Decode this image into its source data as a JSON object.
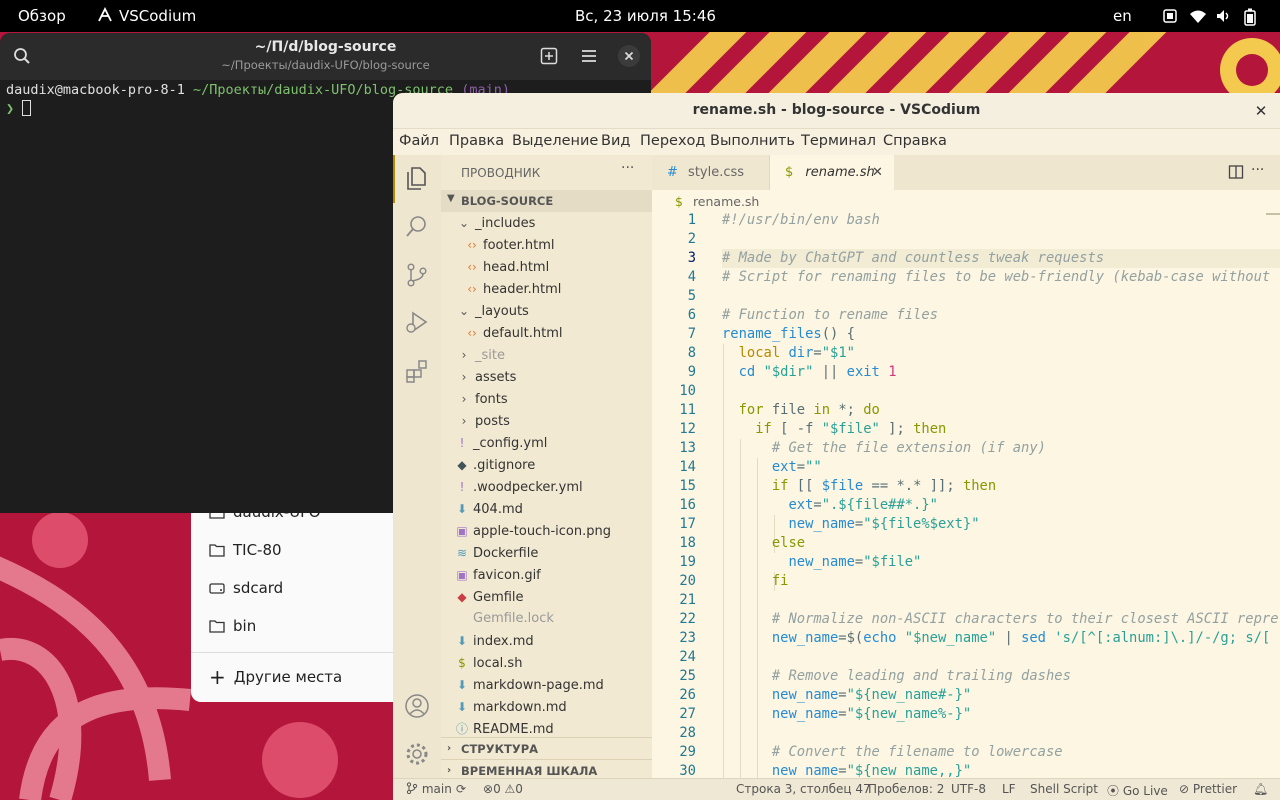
{
  "topbar": {
    "activities": "Обзор",
    "app_name": "VSCodium",
    "clock": "Вс, 23 июля  15:46",
    "lang": "en"
  },
  "nautilus": {
    "items": [
      {
        "label": "daudix-UFO",
        "icon": "folder-icon"
      },
      {
        "label": "TIC-80",
        "icon": "folder-icon"
      },
      {
        "label": "sdcard",
        "icon": "drive-icon"
      },
      {
        "label": "bin",
        "icon": "folder-icon"
      }
    ],
    "other_places": "Другие места"
  },
  "terminal": {
    "title": "~/П/d/blog-source",
    "subtitle": "~/Проекты/daudix-UFO/blog-source",
    "prompt_user": "daudix",
    "prompt_host": "@macbook-pro-8-1",
    "prompt_path": "~/Проекты/daudix-UFO/blog-source",
    "prompt_branch": "(main)",
    "prompt_symbol": "❯"
  },
  "vscode": {
    "title": "rename.sh - blog-source - VSCodium",
    "menu": [
      "Файл",
      "Правка",
      "Выделение",
      "Вид",
      "Переход",
      "Выполнить",
      "Терминал",
      "Справка"
    ],
    "explorer": {
      "header": "ПРОВОДНИК",
      "more": "···",
      "root": "BLOG-SOURCE",
      "tree": [
        {
          "label": "_includes",
          "type": "folder-open",
          "depth": 1
        },
        {
          "label": "footer.html",
          "type": "html",
          "depth": 2
        },
        {
          "label": "head.html",
          "type": "html",
          "depth": 2
        },
        {
          "label": "header.html",
          "type": "html",
          "depth": 2
        },
        {
          "label": "_layouts",
          "type": "folder-open",
          "depth": 1
        },
        {
          "label": "default.html",
          "type": "html",
          "depth": 2
        },
        {
          "label": "_site",
          "type": "folder",
          "depth": 1,
          "dim": true
        },
        {
          "label": "assets",
          "type": "folder",
          "depth": 1
        },
        {
          "label": "fonts",
          "type": "folder",
          "depth": 1
        },
        {
          "label": "posts",
          "type": "folder",
          "depth": 1
        },
        {
          "label": "_config.yml",
          "type": "yml",
          "depth": 1
        },
        {
          "label": ".gitignore",
          "type": "git",
          "depth": 1
        },
        {
          "label": ".woodpecker.yml",
          "type": "yml",
          "depth": 1
        },
        {
          "label": "404.md",
          "type": "md",
          "depth": 1
        },
        {
          "label": "apple-touch-icon.png",
          "type": "img",
          "depth": 1
        },
        {
          "label": "Dockerfile",
          "type": "docker",
          "depth": 1
        },
        {
          "label": "favicon.gif",
          "type": "img",
          "depth": 1
        },
        {
          "label": "Gemfile",
          "type": "ruby",
          "depth": 1
        },
        {
          "label": "Gemfile.lock",
          "type": "lock",
          "depth": 1,
          "dim": true
        },
        {
          "label": "index.md",
          "type": "md",
          "depth": 1
        },
        {
          "label": "local.sh",
          "type": "sh",
          "depth": 1
        },
        {
          "label": "markdown-page.md",
          "type": "md",
          "depth": 1
        },
        {
          "label": "markdown.md",
          "type": "md",
          "depth": 1
        },
        {
          "label": "README.md",
          "type": "info",
          "depth": 1
        }
      ],
      "outline": "СТРУКТУРА",
      "timeline": "ВРЕМЕННАЯ ШКАЛА"
    },
    "tabs": [
      {
        "label": "style.css",
        "icon": "#",
        "active": false
      },
      {
        "label": "rename.sh",
        "icon": "$",
        "active": true
      }
    ],
    "breadcrumb": "rename.sh",
    "code": [
      "#!/usr/bin/env bash",
      "",
      "# Made by ChatGPT and countless tweak requests",
      "# Script for renaming files to be web-friendly (kebab-case without",
      "",
      "# Function to rename files",
      "rename_files() {",
      "  local dir=\"$1\"",
      "  cd \"$dir\" || exit 1",
      "",
      "  for file in *; do",
      "    if [ -f \"$file\" ]; then",
      "      # Get the file extension (if any)",
      "      ext=\"\"",
      "      if [[ $file == *.* ]]; then",
      "        ext=\".${file##*.}\"",
      "        new_name=\"${file%$ext}\"",
      "      else",
      "        new_name=\"$file\"",
      "      fi",
      "",
      "      # Normalize non-ASCII characters to their closest ASCII repre",
      "      new_name=$(echo \"$new_name\" | sed 's/[^[:alnum:]\\.]/-/g; s/[",
      "",
      "      # Remove leading and trailing dashes",
      "      new_name=\"${new_name#-}\"",
      "      new_name=\"${new_name%-}\"",
      "",
      "      # Convert the filename to lowercase",
      "      new_name=\"${new_name,,}\""
    ],
    "status": {
      "branch": "main",
      "errors": "0",
      "warnings": "0",
      "position": "Строка 3, столбец 47",
      "spaces": "Пробелов: 2",
      "encoding": "UTF-8",
      "eol": "LF",
      "language": "Shell Script",
      "golive": "Go Live",
      "prettier": "Prettier"
    }
  },
  "colors": {
    "wallpaper_red": "#c4153a",
    "wallpaper_yellow": "#f2c84b",
    "editor_bg": "#fdf6e3",
    "terminal_bg": "#1d1d1d"
  }
}
